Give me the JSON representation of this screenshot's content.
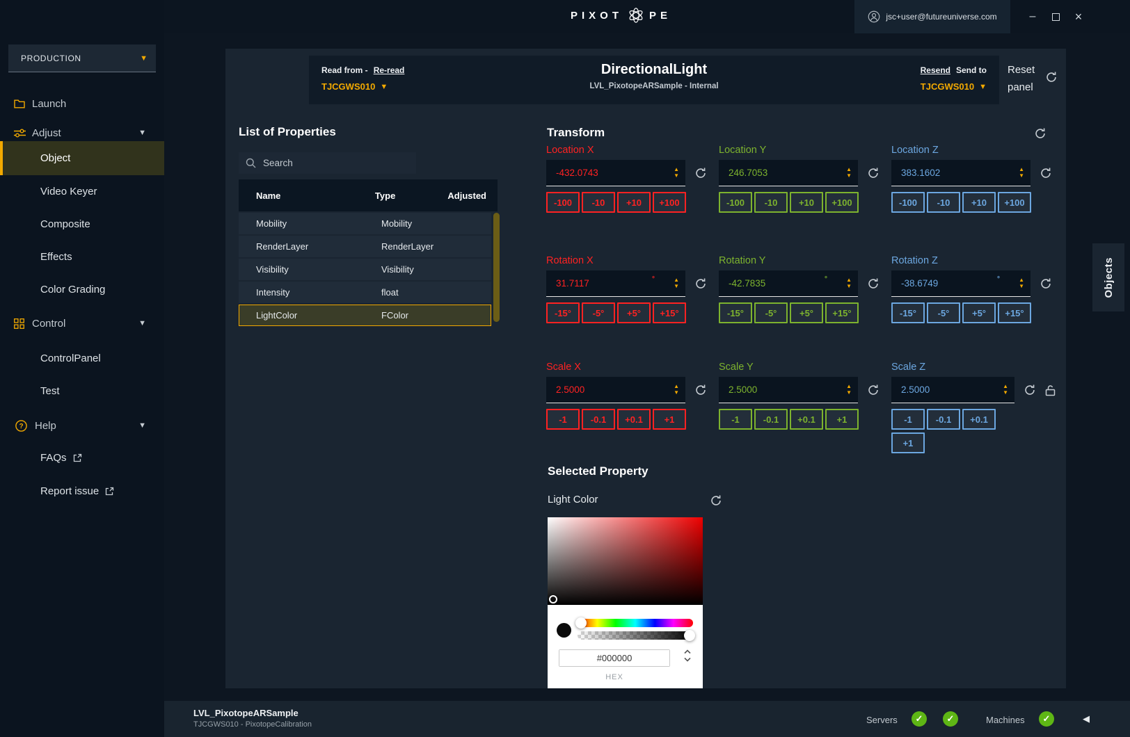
{
  "colors": {
    "accent": "#f2a900",
    "axis_x": "#ff2222",
    "axis_y": "#7db32e",
    "axis_z": "#6ca7e0",
    "status_ok": "#5eb615"
  },
  "titlebar": {
    "logo_text_left": "PIXOT",
    "logo_text_right": "PE",
    "user_email": "jsc+user@futureuniverse.com",
    "minimize_glyph": "–",
    "close_glyph": "×"
  },
  "sidebar": {
    "production_label": "PRODUCTION",
    "launch_label": "Launch",
    "adjust_label": "Adjust",
    "adjust_items": [
      "Object",
      "Video Keyer",
      "Composite",
      "Effects",
      "Color Grading"
    ],
    "control_label": "Control",
    "control_items": [
      "ControlPanel",
      "Test"
    ],
    "help_label": "Help",
    "help_items": [
      "FAQs",
      "Report issue"
    ]
  },
  "panel_header": {
    "read_from_label": "Read from -",
    "reread_link": "Re-read",
    "read_from_machine": "TJCGWS010",
    "title": "DirectionalLight",
    "subtitle": "LVL_PixotopeARSample - Internal",
    "resend_link": "Resend",
    "send_to_label": "Send to",
    "send_to_machine": "TJCGWS010",
    "reset_panel_label": "Reset panel"
  },
  "properties": {
    "title": "List of Properties",
    "search_placeholder": "Search",
    "columns": [
      "Name",
      "Type",
      "Adjusted"
    ],
    "rows": [
      {
        "name": "Mobility",
        "type": "Mobility"
      },
      {
        "name": "RenderLayer",
        "type": "RenderLayer"
      },
      {
        "name": "Visibility",
        "type": "Visibility"
      },
      {
        "name": "Intensity",
        "type": "float"
      },
      {
        "name": "LightColor",
        "type": "FColor"
      }
    ],
    "selected_row": "LightColor"
  },
  "transform": {
    "title": "Transform",
    "groups": [
      {
        "label": "Location X",
        "value": "-432.0743",
        "unit": "",
        "axis": "x",
        "buttons": [
          "-100",
          "-10",
          "+10",
          "+100"
        ]
      },
      {
        "label": "Location Y",
        "value": "246.7053",
        "unit": "",
        "axis": "y",
        "buttons": [
          "-100",
          "-10",
          "+10",
          "+100"
        ]
      },
      {
        "label": "Location Z",
        "value": "383.1602",
        "unit": "",
        "axis": "z",
        "buttons": [
          "-100",
          "-10",
          "+10",
          "+100"
        ]
      },
      {
        "label": "Rotation X",
        "value": "31.7117",
        "unit": "°",
        "axis": "x",
        "buttons": [
          "-15°",
          "-5°",
          "+5°",
          "+15°"
        ]
      },
      {
        "label": "Rotation Y",
        "value": "-42.7835",
        "unit": "°",
        "axis": "y",
        "buttons": [
          "-15°",
          "-5°",
          "+5°",
          "+15°"
        ]
      },
      {
        "label": "Rotation Z",
        "value": "-38.6749",
        "unit": "°",
        "axis": "z",
        "buttons": [
          "-15°",
          "-5°",
          "+5°",
          "+15°"
        ]
      },
      {
        "label": "Scale X",
        "value": "2.5000",
        "unit": "",
        "axis": "x",
        "buttons": [
          "-1",
          "-0.1",
          "+0.1",
          "+1"
        ]
      },
      {
        "label": "Scale Y",
        "value": "2.5000",
        "unit": "",
        "axis": "y",
        "buttons": [
          "-1",
          "-0.1",
          "+0.1",
          "+1"
        ]
      },
      {
        "label": "Scale Z",
        "value": "2.5000",
        "unit": "",
        "axis": "z",
        "buttons": [
          "-1",
          "-0.1",
          "+0.1",
          "+1"
        ],
        "narrow": true,
        "lock": true
      }
    ]
  },
  "selected_property": {
    "title": "Selected Property",
    "property_label": "Light Color",
    "hex_value": "#000000",
    "hex_label": "HEX"
  },
  "right_tab_label": "Objects",
  "statusbar": {
    "level_name": "LVL_PixotopeARSample",
    "connection_info": "TJCGWS010 - PixotopeCalibration",
    "servers_label": "Servers",
    "machines_label": "Machines"
  }
}
